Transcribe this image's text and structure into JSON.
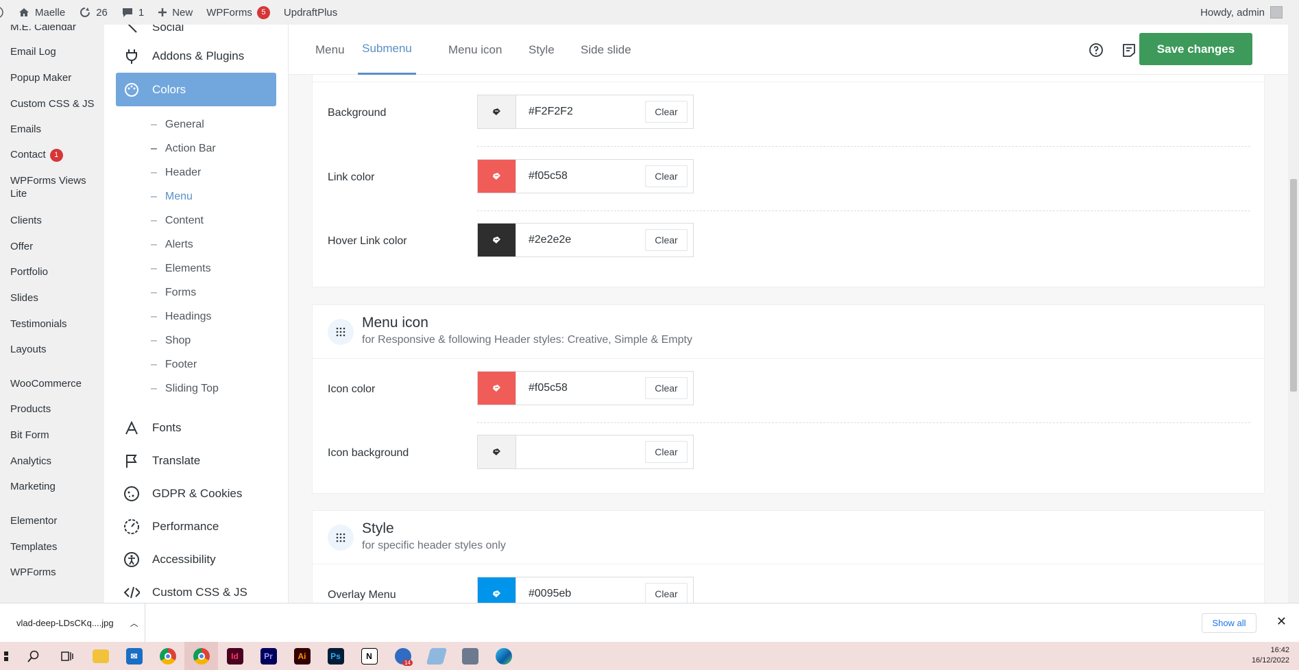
{
  "adminbar": {
    "site_name": "Maelle",
    "updates_count": "26",
    "comments_count": "1",
    "new_label": "New",
    "wpforms_label": "WPForms",
    "wpforms_badge": "5",
    "updraft_label": "UpdraftPlus",
    "howdy": "Howdy, admin"
  },
  "wpmenu": {
    "calendar": "M.E. Calendar",
    "email_log": "Email Log",
    "popup_maker": "Popup Maker",
    "custom_css": "Custom CSS & JS",
    "emails": "Emails",
    "contact": "Contact",
    "contact_badge": "1",
    "wpforms_views": "WPForms Views Lite",
    "clients": "Clients",
    "offer": "Offer",
    "portfolio": "Portfolio",
    "slides": "Slides",
    "testimonials": "Testimonials",
    "layouts": "Layouts",
    "woocommerce": "WooCommerce",
    "products": "Products",
    "bit_form": "Bit Form",
    "analytics": "Analytics",
    "marketing": "Marketing",
    "elementor": "Elementor",
    "templates": "Templates",
    "wpforms": "WPForms"
  },
  "sidebar": {
    "social": "Social",
    "addons": "Addons & Plugins",
    "colors": "Colors",
    "sub": [
      "General",
      "Action Bar",
      "Header",
      "Menu",
      "Content",
      "Alerts",
      "Elements",
      "Forms",
      "Headings",
      "Shop",
      "Footer",
      "Sliding Top"
    ],
    "fonts": "Fonts",
    "translate": "Translate",
    "gdpr": "GDPR & Cookies",
    "performance": "Performance",
    "accessibility": "Accessibility",
    "custom_css": "Custom CSS & JS"
  },
  "tabs": [
    "Menu",
    "Submenu",
    "Menu icon",
    "Style",
    "Side slide"
  ],
  "save_label": "Save changes",
  "clear_label": "Clear",
  "submenu": {
    "rows": [
      {
        "label": "Background",
        "value": "#F2F2F2",
        "swatch": "#f2f2f2"
      },
      {
        "label": "Link color",
        "value": "#f05c58",
        "swatch": "#f05c58"
      },
      {
        "label": "Hover Link color",
        "value": "#2e2e2e",
        "swatch": "#2e2e2e"
      }
    ]
  },
  "menu_icon": {
    "title": "Menu icon",
    "subtitle": "for Responsive & following Header styles: Creative, Simple & Empty",
    "rows": [
      {
        "label": "Icon color",
        "value": "#f05c58",
        "swatch": "#f05c58"
      },
      {
        "label": "Icon background",
        "value": "",
        "swatch": "#f2f2f2"
      }
    ]
  },
  "style_section": {
    "title": "Style",
    "subtitle": "for specific header styles only",
    "rows": [
      {
        "label": "Overlay Menu",
        "value": "#0095eb",
        "swatch": "#0095eb"
      }
    ]
  },
  "download": {
    "filename": "vlad-deep-LDsCKq....jpg",
    "show_all": "Show all"
  },
  "taskbar": {
    "time": "16:42",
    "date": "16/12/2022",
    "mail_badge": "14"
  },
  "colors": {
    "accent": "#5b8fc7",
    "save_green": "#3d9a5a",
    "active_sidebar": "#72a7dd"
  }
}
